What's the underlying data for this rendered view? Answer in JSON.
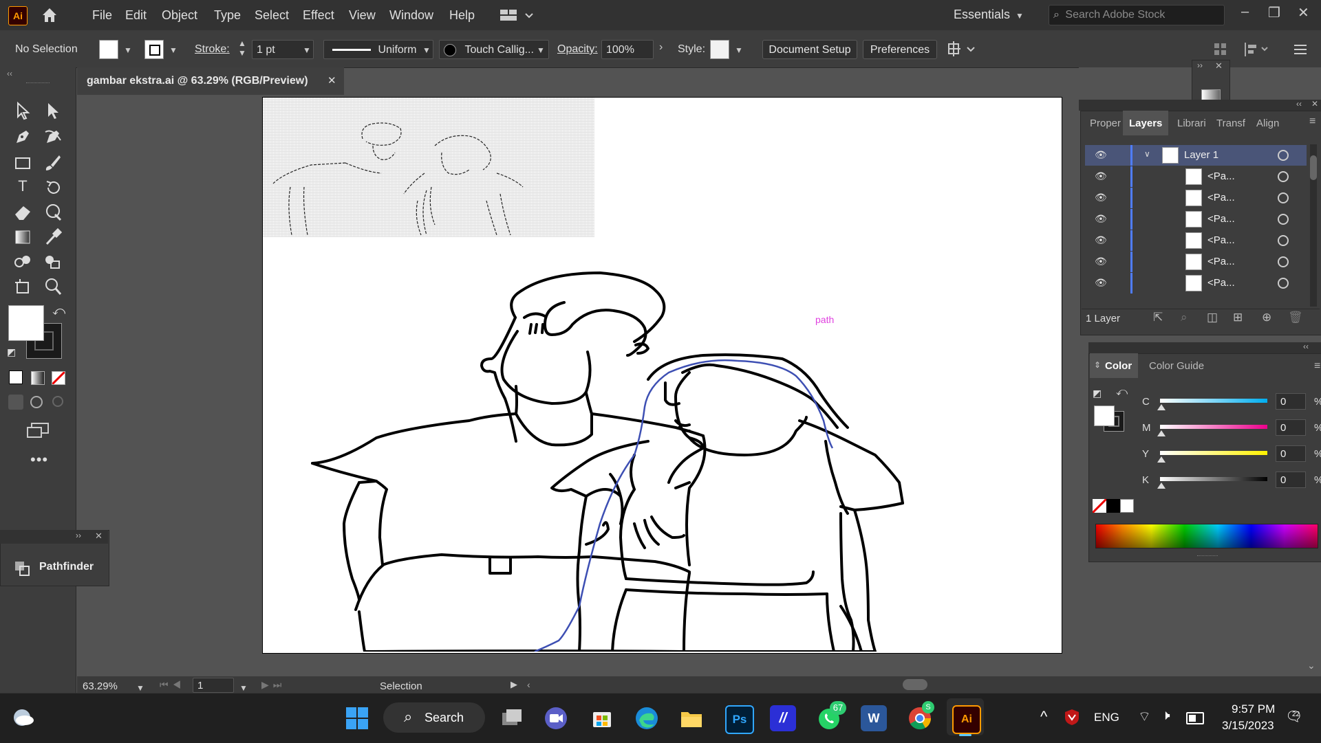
{
  "app": {
    "logo": "Ai",
    "accent": "#ff9a00"
  },
  "menu": [
    "File",
    "Edit",
    "Object",
    "Type",
    "Select",
    "Effect",
    "View",
    "Window",
    "Help"
  ],
  "workspace": "Essentials",
  "search": {
    "placeholder": "Search Adobe Stock"
  },
  "control": {
    "selection": "No Selection",
    "stroke_label": "Stroke:",
    "stroke_value": "1 pt",
    "profile": "Uniform",
    "brush": "Touch Callig...",
    "opacity_label": "Opacity:",
    "opacity_value": "100%",
    "style_label": "Style:",
    "document_setup": "Document Setup",
    "preferences": "Preferences"
  },
  "document": {
    "tab_title": "gambar ekstra.ai @ 63.29% (RGB/Preview)",
    "close": "✕"
  },
  "canvas": {
    "path_label": "path"
  },
  "left_panel": {
    "pathfinder": "Pathfinder"
  },
  "layers_panel": {
    "tabs": [
      "Proper",
      "Layers",
      "Librari",
      "Transf",
      "Align"
    ],
    "active_tab": "Layers",
    "rows": [
      {
        "name": "Layer 1",
        "top": true
      },
      {
        "name": "<Pa..."
      },
      {
        "name": "<Pa..."
      },
      {
        "name": "<Pa..."
      },
      {
        "name": "<Pa..."
      },
      {
        "name": "<Pa..."
      },
      {
        "name": "<Pa..."
      }
    ],
    "footer": "1 Layer"
  },
  "color_panel": {
    "tabs": [
      "Color",
      "Color Guide"
    ],
    "sliders": [
      {
        "label": "C",
        "value": "0",
        "color": "#00aeef"
      },
      {
        "label": "M",
        "value": "0",
        "color": "#ec008c"
      },
      {
        "label": "Y",
        "value": "0",
        "color": "#fff200"
      },
      {
        "label": "K",
        "value": "0",
        "color": "#000000"
      }
    ],
    "unit": "%"
  },
  "status": {
    "zoom": "63.29%",
    "artboard": "1",
    "tool": "Selection"
  },
  "taskbar": {
    "search": "Search",
    "whatsapp_badge": "67",
    "chrome_badge": "S",
    "lang": "ENG",
    "time": "9:57 PM",
    "date": "3/15/2023",
    "notif_badge": "22"
  }
}
